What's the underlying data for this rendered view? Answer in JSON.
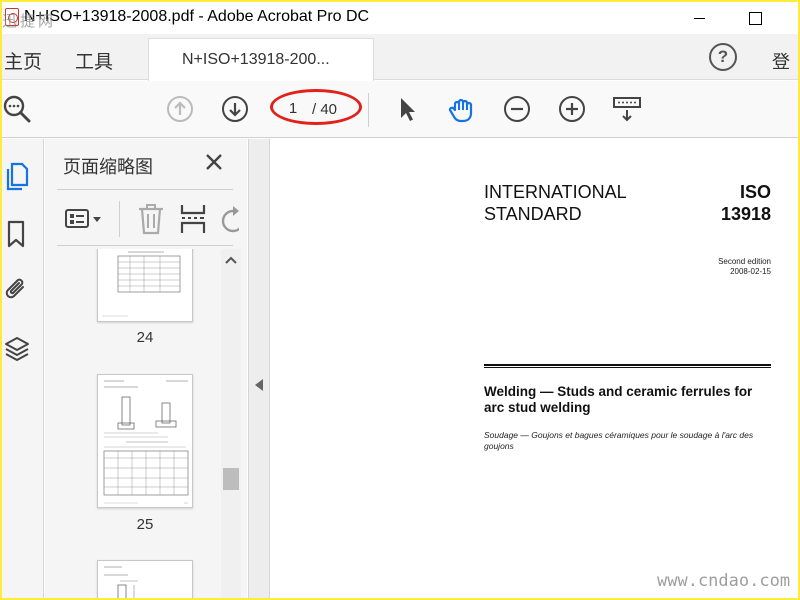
{
  "window": {
    "title": "N+ISO+13918-2008.pdf - Adobe Acrobat Pro DC",
    "watermark_top": "迅捷网",
    "watermark_bottom": "www.cndao.com"
  },
  "menu": {
    "home": "主页",
    "tools": "工具",
    "doc_tab": "N+ISO+13918-200...",
    "signin": "登"
  },
  "toolbar": {
    "page_current": "1",
    "page_total": "/ 40",
    "icons": [
      "search-icon",
      "arrow-up-icon",
      "arrow-down-icon",
      "pointer-icon",
      "hand-icon",
      "zoom-out-icon",
      "zoom-in-icon",
      "keyboard-icon"
    ]
  },
  "thumbnail_panel": {
    "title": "页面缩略图",
    "thumbnails": [
      {
        "page": "24"
      },
      {
        "page": "25"
      }
    ]
  },
  "document": {
    "header_left_line1": "INTERNATIONAL",
    "header_left_line2": "STANDARD",
    "header_right_line1": "ISO",
    "header_right_line2": "13918",
    "edition": "Second edition",
    "date": "2008-02-15",
    "title_en": "Welding — Studs and ceramic ferrules for arc stud welding",
    "title_fr": "Soudage — Goujons et bagues céramiques pour le soudage à l'arc des goujons"
  },
  "colors": {
    "accent_blue": "#1473e6",
    "annotation_red": "#e0221b",
    "border_yellow": "#ffeb3b"
  }
}
